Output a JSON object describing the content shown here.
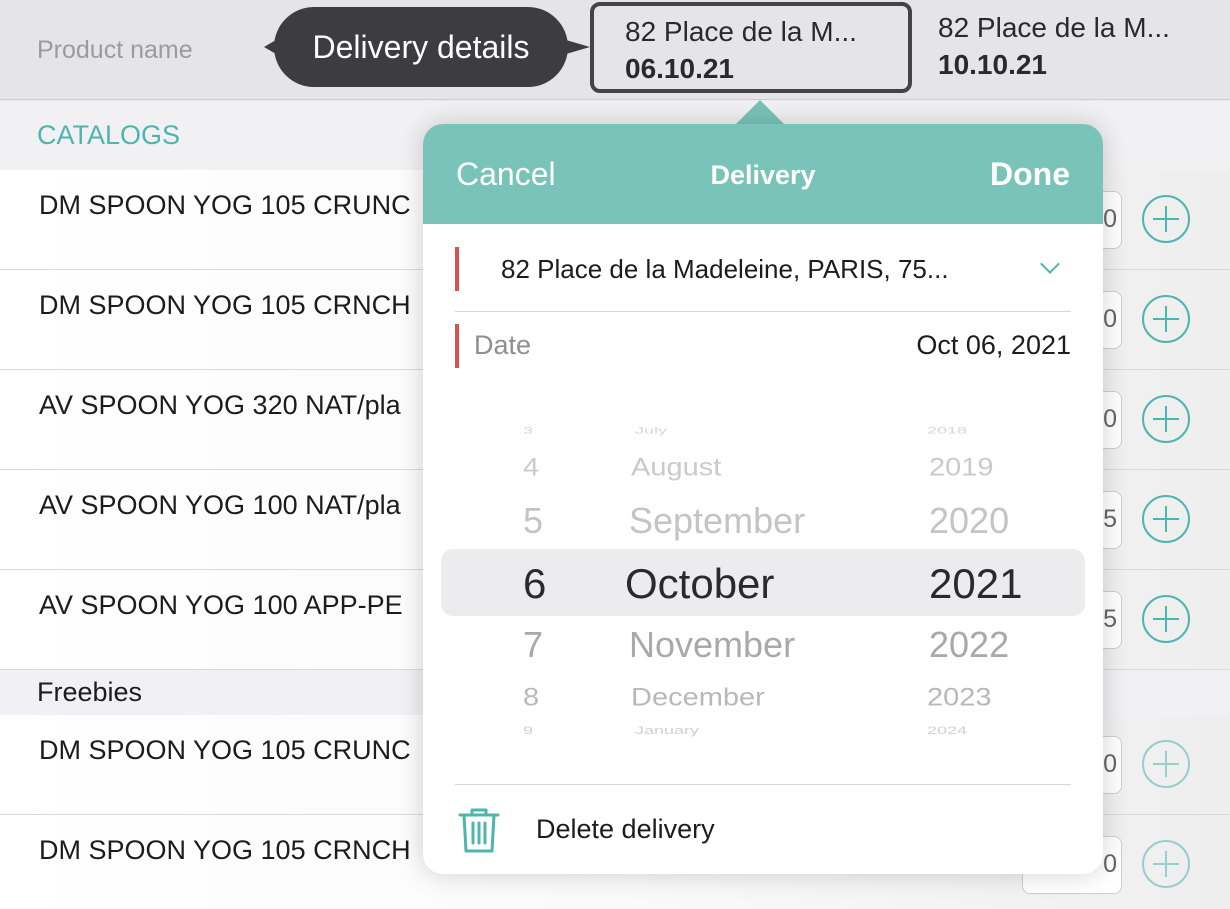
{
  "header": {
    "product_name_label": "Product name",
    "tooltip": "Delivery details",
    "deliveries": [
      {
        "address": "82 Place de la M...",
        "date": "06.10.21"
      },
      {
        "address": "82 Place de la M...",
        "date": "10.10.21"
      }
    ]
  },
  "sections": {
    "catalogs": "CATALOGS",
    "freebies": "Freebies"
  },
  "catalog_items": [
    {
      "name": "DM SPOON YOG 105 CRUNC",
      "qty": "0"
    },
    {
      "name": "DM SPOON YOG 105 CRNCH",
      "qty": "0"
    },
    {
      "name": "AV SPOON YOG 320 NAT/pla",
      "qty": "0"
    },
    {
      "name": "AV SPOON YOG 100 NAT/pla",
      "qty": "5"
    },
    {
      "name": "AV SPOON YOG 100 APP-PE",
      "qty": "5"
    }
  ],
  "freebie_items": [
    {
      "name": "DM SPOON YOG 105 CRUNC",
      "qty": "0"
    },
    {
      "name": "DM SPOON YOG 105 CRNCH",
      "qty": "0"
    }
  ],
  "popover": {
    "cancel_label": "Cancel",
    "title": "Delivery",
    "done_label": "Done",
    "address_value": "82 Place de la Madeleine, PARIS, 75...",
    "date_label": "Date",
    "date_value": "Oct 06, 2021",
    "picker": {
      "days": [
        "3",
        "4",
        "5",
        "6",
        "7",
        "8",
        "9"
      ],
      "months": [
        "July",
        "August",
        "September",
        "October",
        "November",
        "December",
        "January"
      ],
      "years": [
        "2018",
        "2019",
        "2020",
        "2021",
        "2022",
        "2023",
        "2024"
      ],
      "selected": {
        "day": "6",
        "month": "October",
        "year": "2021"
      }
    },
    "delete_label": "Delete delivery"
  },
  "colors": {
    "accent": "#4eb5ae",
    "popover_header": "#79c3b8",
    "required_bar": "#d9534f",
    "tooltip_bg": "#3d3d3f"
  }
}
